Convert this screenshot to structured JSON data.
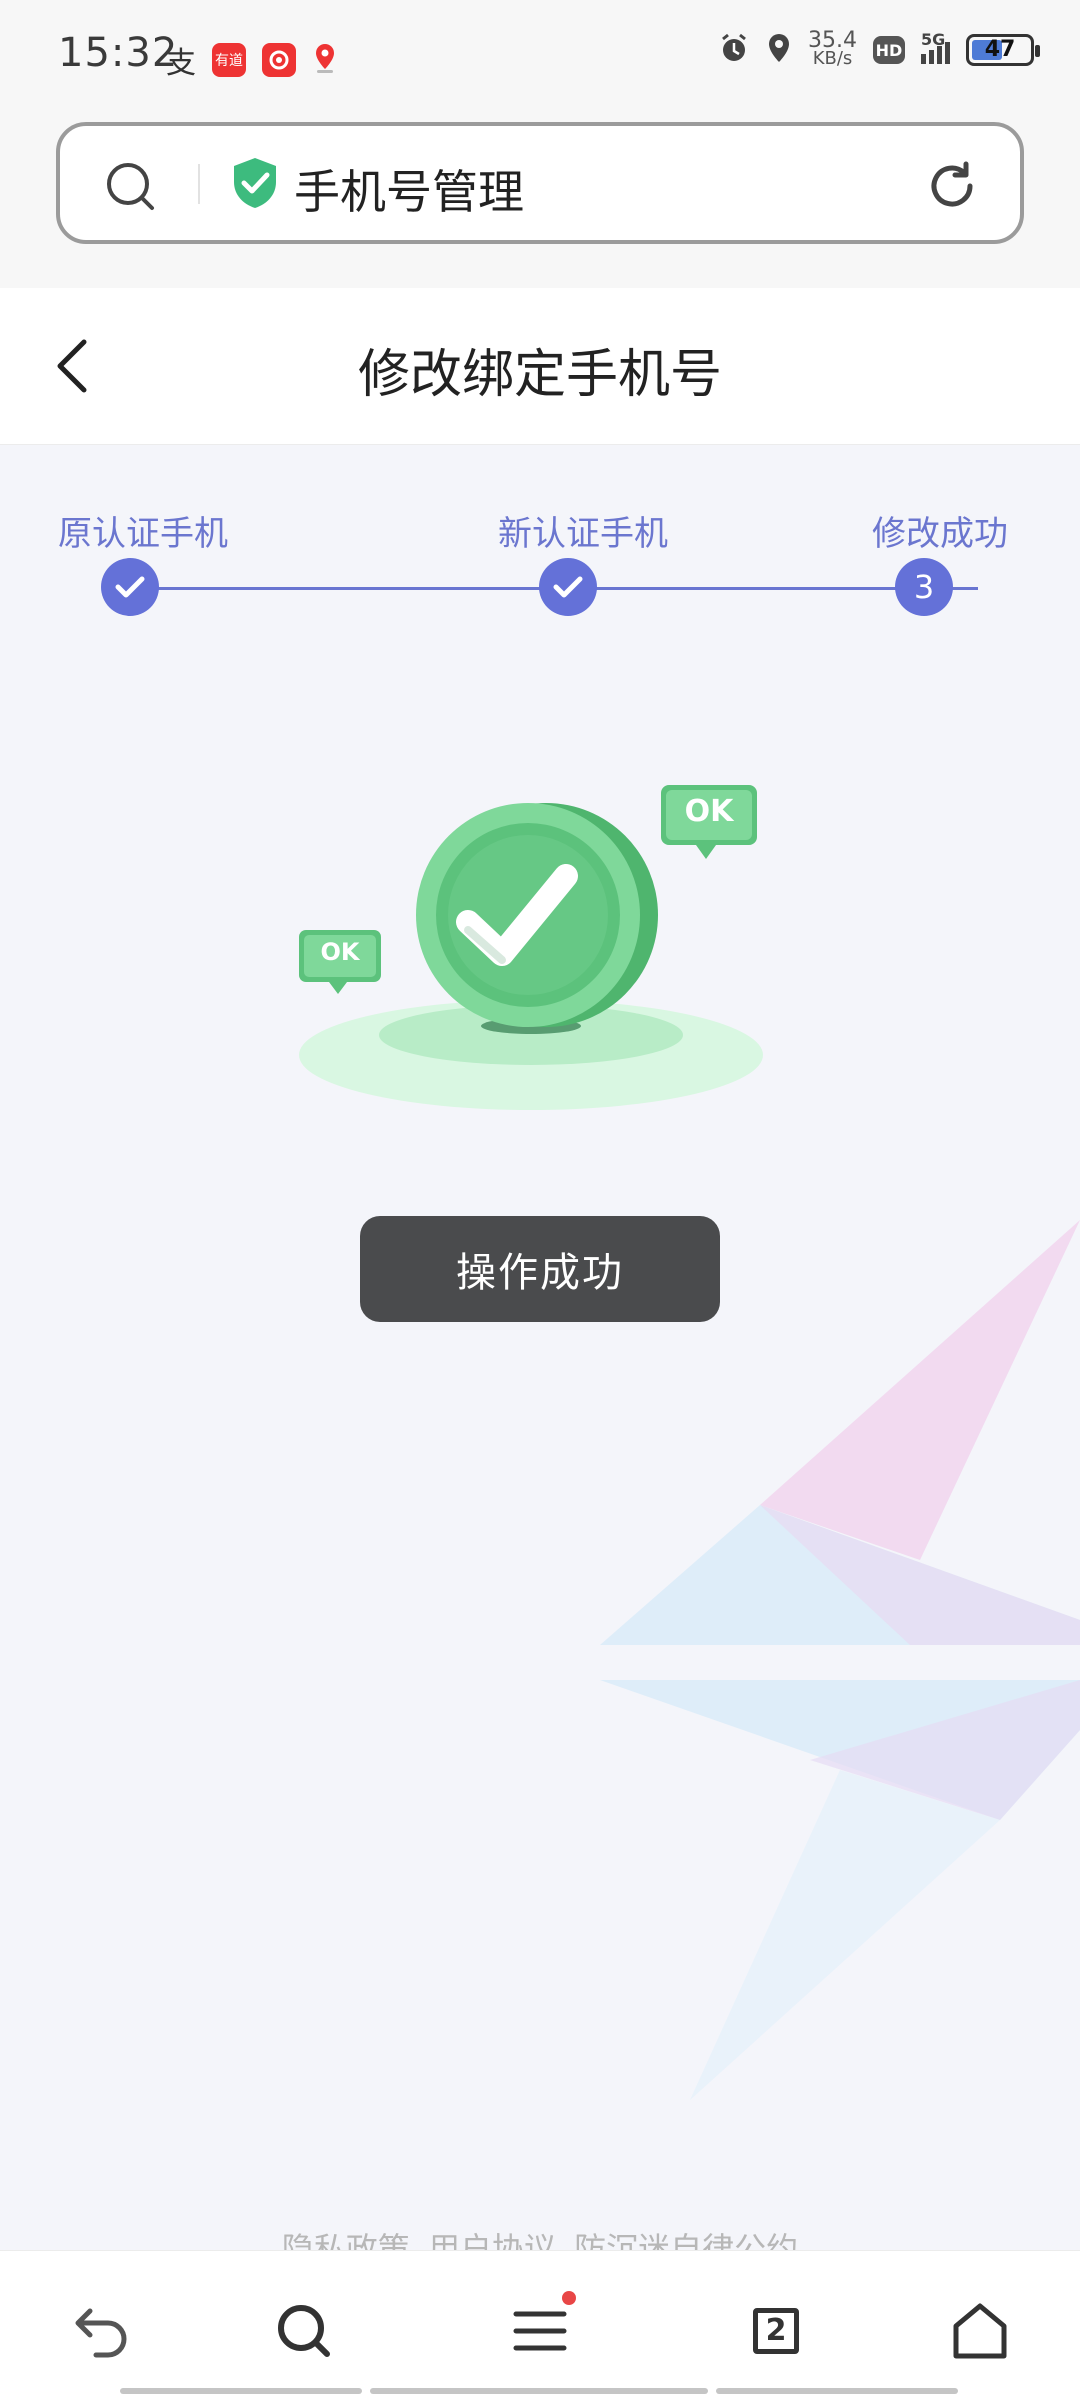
{
  "status_bar": {
    "time": "15:32",
    "notif_icons": [
      "alipay-icon",
      "youdao-icon",
      "netease-music-icon",
      "maps-icon"
    ],
    "speed_value": "35.4",
    "speed_unit": "KB/s",
    "hd": "HD",
    "network": "5G",
    "battery": "47"
  },
  "address_bar": {
    "title": "手机号管理"
  },
  "header": {
    "title": "修改绑定手机号"
  },
  "steps": [
    {
      "label": "原认证手机",
      "state": "done"
    },
    {
      "label": "新认证手机",
      "state": "done"
    },
    {
      "label": "修改成功",
      "state": "current",
      "number": "3"
    }
  ],
  "illustration": {
    "badge_big": "OK",
    "badge_small": "OK"
  },
  "toast": {
    "text": "操作成功"
  },
  "footer": {
    "links": [
      "隐私政策",
      "用户协议",
      "防沉迷自律公约"
    ]
  },
  "bottom_nav": {
    "tab_count": "2"
  },
  "colors": {
    "accent": "#6471d8",
    "success_green": "#5cc27c",
    "toast_bg": "#4a4b4d"
  }
}
